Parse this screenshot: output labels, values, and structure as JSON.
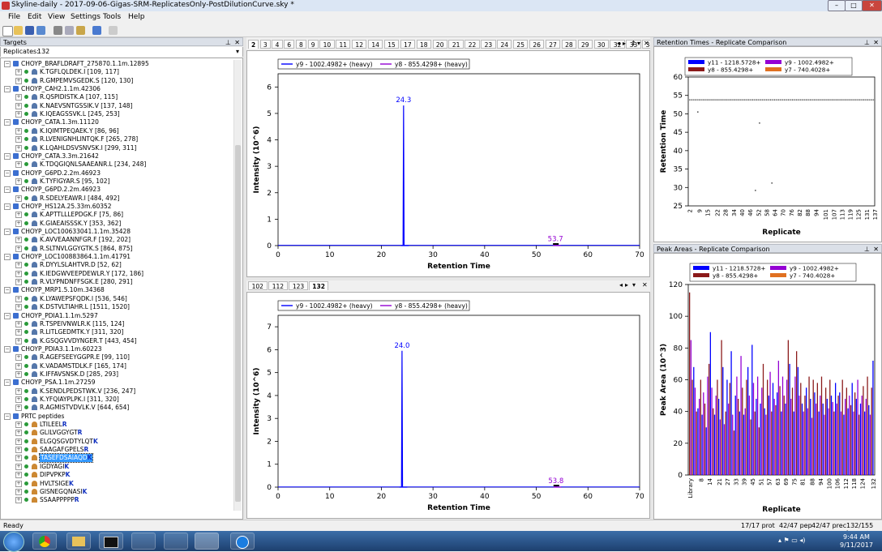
{
  "window": {
    "title": "Skyline-daily - 2017-09-06-Gigas-SRM-ReplicatesOnly-PostDilutionCurve.sky *",
    "buttons": [
      "–",
      "□",
      "✕"
    ]
  },
  "menu": [
    "File",
    "Edit",
    "View",
    "Settings",
    "Tools",
    "Help"
  ],
  "targets": {
    "title": "Targets",
    "replicates_label": "Replicates:",
    "replicates_value": "132",
    "rows": [
      {
        "level": 0,
        "kind": "protein",
        "text": "CHOYP_BRAFLDRAFT_275870.1.1m.12895"
      },
      {
        "level": 1,
        "kind": "peptide",
        "text": "K.TGFLQLDEK.I [109, 117]"
      },
      {
        "level": 1,
        "kind": "peptide",
        "text": "R.GMPEMVSGEDK.S [120, 130]"
      },
      {
        "level": 0,
        "kind": "protein",
        "text": "CHOYP_CAH2.1.1m.42306"
      },
      {
        "level": 1,
        "kind": "peptide",
        "text": "R.QSPIDISTK.A [107, 115]"
      },
      {
        "level": 1,
        "kind": "peptide",
        "text": "K.NAEVSNTGSSIK.V [137, 148]"
      },
      {
        "level": 1,
        "kind": "peptide",
        "text": "K.IQEAGSSVK.L [245, 253]"
      },
      {
        "level": 0,
        "kind": "protein",
        "text": "CHOYP_CATA.1.3m.11120"
      },
      {
        "level": 1,
        "kind": "peptide",
        "text": "K.IQIMTPEQAEK.Y [86, 96]"
      },
      {
        "level": 1,
        "kind": "peptide",
        "text": "R.LVENIGNHLINTQK.F [265, 278]"
      },
      {
        "level": 1,
        "kind": "peptide",
        "text": "K.LQAHLDSVSNVSK.I [299, 311]"
      },
      {
        "level": 0,
        "kind": "protein",
        "text": "CHOYP_CATA.3.3m.21642"
      },
      {
        "level": 1,
        "kind": "peptide",
        "text": "K.TDQGIQNLSAAEANR.L [234, 248]"
      },
      {
        "level": 0,
        "kind": "protein",
        "text": "CHOYP_G6PD.2.2m.46923"
      },
      {
        "level": 1,
        "kind": "peptide",
        "text": "K.TYFIGYAR.S [95, 102]"
      },
      {
        "level": 0,
        "kind": "protein",
        "text": "CHOYP_G6PD.2.2m.46923"
      },
      {
        "level": 1,
        "kind": "peptide",
        "text": "R.SDELYEAWR.I [484, 492]"
      },
      {
        "level": 0,
        "kind": "protein",
        "text": "CHOYP_HS12A.25.33m.60352"
      },
      {
        "level": 1,
        "kind": "peptide",
        "text": "K.APTTLLLEPDGK.F [75, 86]"
      },
      {
        "level": 1,
        "kind": "peptide",
        "text": "K.GIAEAISSSK.Y [353, 362]"
      },
      {
        "level": 0,
        "kind": "protein",
        "text": "CHOYP_LOC100633041.1.1m.35428"
      },
      {
        "level": 1,
        "kind": "peptide",
        "text": "K.AVVEAANNFGR.F [192, 202]"
      },
      {
        "level": 1,
        "kind": "peptide",
        "text": "R.SLTNVLGGYGTK.S [864, 875]"
      },
      {
        "level": 0,
        "kind": "protein",
        "text": "CHOYP_LOC100883864.1.1m.41791"
      },
      {
        "level": 1,
        "kind": "peptide",
        "text": "R.DYYLSLAHTVR.D [52, 62]"
      },
      {
        "level": 1,
        "kind": "peptide",
        "text": "K.IEDGWVEEPDEWLR.Y [172, 186]"
      },
      {
        "level": 1,
        "kind": "peptide",
        "text": "R.VLYPNDNFFSGK.E [280, 291]"
      },
      {
        "level": 0,
        "kind": "protein",
        "text": "CHOYP_MRP1.5.10m.34368"
      },
      {
        "level": 1,
        "kind": "peptide",
        "text": "K.LYAWEPSFQDK.I [536, 546]"
      },
      {
        "level": 1,
        "kind": "peptide",
        "text": "K.DSTVLTIAHR.L [1511, 1520]"
      },
      {
        "level": 0,
        "kind": "protein",
        "text": "CHOYP_PDIA1.1.1m.5297"
      },
      {
        "level": 1,
        "kind": "peptide",
        "text": "R.TSPEIVNWLR.K [115, 124]"
      },
      {
        "level": 1,
        "kind": "peptide",
        "text": "R.LITLGEDMTK.Y [311, 320]"
      },
      {
        "level": 1,
        "kind": "peptide",
        "text": "K.GSQGVVDYNGER.T [443, 454]"
      },
      {
        "level": 0,
        "kind": "protein",
        "text": "CHOYP_PDIA3.1.1m.60223"
      },
      {
        "level": 1,
        "kind": "peptide",
        "text": "R.AGEFSEEYGGPR.E [99, 110]"
      },
      {
        "level": 1,
        "kind": "peptide",
        "text": "K.VADAMSTDLK.F [165, 174]"
      },
      {
        "level": 1,
        "kind": "peptide",
        "text": "K.IFFAVSNSK.D [285, 293]"
      },
      {
        "level": 0,
        "kind": "protein",
        "text": "CHOYP_PSA.1.1m.27259"
      },
      {
        "level": 1,
        "kind": "peptide",
        "text": "K.SENDLPEDSTWK.V [236, 247]"
      },
      {
        "level": 1,
        "kind": "peptide",
        "text": "K.YFQIAYPLPK.I [311, 320]"
      },
      {
        "level": 1,
        "kind": "peptide",
        "text": "R.AGMISTVDVLK.V [644, 654]"
      },
      {
        "level": 0,
        "kind": "protein",
        "text": "PRTC peptides"
      },
      {
        "level": 1,
        "kind": "std",
        "text": "LTILEEL",
        "tail": "R"
      },
      {
        "level": 1,
        "kind": "std",
        "text": "GLILVGGYGT",
        "tail": "R"
      },
      {
        "level": 1,
        "kind": "std",
        "text": "ELGQSGVDTYLQT",
        "tail": "K"
      },
      {
        "level": 1,
        "kind": "std",
        "text": "SAAGAFGPELS",
        "tail": "R"
      },
      {
        "level": 1,
        "kind": "std",
        "text": "TASEFDSAIAQD",
        "tail": "K",
        "selected": true
      },
      {
        "level": 1,
        "kind": "std",
        "text": "IGDYAGI",
        "tail": "K"
      },
      {
        "level": 1,
        "kind": "std",
        "text": "DIPVPKP",
        "tail": "K"
      },
      {
        "level": 1,
        "kind": "std",
        "text": "HVLTSIGE",
        "tail": "K"
      },
      {
        "level": 1,
        "kind": "std",
        "text": "GISNEGQNASI",
        "tail": "K"
      },
      {
        "level": 1,
        "kind": "std",
        "text": "SSAAPPPPP",
        "tail": "R"
      }
    ]
  },
  "top_tabs": [
    "2",
    "3",
    "4",
    "6",
    "8",
    "9",
    "10",
    "11",
    "12",
    "14",
    "15",
    "17",
    "18",
    "20",
    "21",
    "22",
    "23",
    "24",
    "25",
    "26",
    "27",
    "28",
    "29",
    "30",
    "32",
    "33",
    "34",
    "35",
    "36",
    "3"
  ],
  "top_tabs_active": "2",
  "bottom_tabs": [
    "102",
    "112",
    "123",
    "132"
  ],
  "bottom_tabs_active": "132",
  "tab_nav": {
    "left": "◂",
    "right": "▸",
    "pin": "↕",
    "dropdown": "▾",
    "close": "✕"
  },
  "chrom_top": {
    "chart_data": {
      "type": "line",
      "xlabel": "Retention Time",
      "ylabel": "Intensity (10^6)",
      "xlim": [
        0,
        70
      ],
      "ylim": [
        0,
        6.5
      ],
      "xticks": [
        "0",
        "10",
        "20",
        "30",
        "40",
        "50",
        "60",
        "70"
      ],
      "yticks": [
        "0",
        "1",
        "2",
        "3",
        "4",
        "5",
        "6"
      ],
      "series": [
        {
          "name": "y9 - 1002.4982+ (heavy)",
          "color": "#0000ff",
          "peaks": [
            {
              "rt": 24.3,
              "height": 5.3,
              "label": "24.3"
            }
          ]
        },
        {
          "name": "y8 - 855.4298+ (heavy)",
          "color": "#9400d3",
          "peaks": [
            {
              "rt": 53.7,
              "height": 0.05,
              "label": "53.7"
            }
          ]
        }
      ]
    }
  },
  "chrom_bottom": {
    "chart_data": {
      "type": "line",
      "xlabel": "Retention Time",
      "ylabel": "Intensity (10^6)",
      "xlim": [
        0,
        70
      ],
      "ylim": [
        0,
        7.5
      ],
      "xticks": [
        "0",
        "10",
        "20",
        "30",
        "40",
        "50",
        "60",
        "70"
      ],
      "yticks": [
        "0",
        "1",
        "2",
        "3",
        "4",
        "5",
        "6",
        "7"
      ],
      "series": [
        {
          "name": "y9 - 1002.4982+ (heavy)",
          "color": "#0000ff",
          "peaks": [
            {
              "rt": 24.0,
              "height": 5.95,
              "label": "24.0"
            }
          ]
        },
        {
          "name": "y8 - 855.4298+ (heavy)",
          "color": "#9400d3",
          "peaks": [
            {
              "rt": 53.8,
              "height": 0.04,
              "label": "53.8"
            }
          ]
        }
      ]
    }
  },
  "rt_panel": {
    "title": "Retention Times - Replicate Comparison",
    "chart_data": {
      "type": "scatter",
      "xlabel": "Replicate",
      "ylabel": "Retention Time",
      "ylim": [
        25,
        60
      ],
      "yticks": [
        "25",
        "30",
        "35",
        "40",
        "45",
        "50",
        "55",
        "60"
      ],
      "xticks": [
        "2",
        "9",
        "15",
        "22",
        "28",
        "34",
        "40",
        "46",
        "52",
        "58",
        "64",
        "70",
        "76",
        "82",
        "88",
        "94",
        "101",
        "107",
        "113",
        "119",
        "125",
        "131",
        "137"
      ],
      "legend": [
        {
          "name": "y11 - 1218.5728+",
          "color": "#0000ff"
        },
        {
          "name": "y9 - 1002.4982+",
          "color": "#9400d3"
        },
        {
          "name": "y8 - 855.4298+",
          "color": "#8b1a1a"
        },
        {
          "name": "y7 - 740.4028+",
          "color": "#e07020"
        }
      ],
      "baseline_rt": 53.8,
      "outliers": [
        {
          "replicate": 8,
          "rt": 50.5
        },
        {
          "replicate": 53,
          "rt": 47.5
        },
        {
          "replicate": 50,
          "rt": 29.2
        },
        {
          "replicate": 62,
          "rt": 31.2
        }
      ]
    }
  },
  "pa_panel": {
    "title": "Peak Areas - Replicate Comparison",
    "chart_data": {
      "type": "bar",
      "xlabel": "Replicate",
      "ylabel": "Peak Area (10^3)",
      "ylim": [
        0,
        120
      ],
      "yticks": [
        "0",
        "20",
        "40",
        "60",
        "80",
        "100",
        "120"
      ],
      "xticks": [
        "Library",
        "8",
        "14",
        "21",
        "27",
        "33",
        "39",
        "45",
        "51",
        "57",
        "63",
        "69",
        "75",
        "81",
        "88",
        "94",
        "100",
        "106",
        "112",
        "118",
        "124",
        "132"
      ],
      "legend": [
        {
          "name": "y11 - 1218.5728+",
          "color": "#0000ff"
        },
        {
          "name": "y9 - 1002.4982+",
          "color": "#9400d3"
        },
        {
          "name": "y8 - 855.4298+",
          "color": "#8b1a1a"
        },
        {
          "name": "y7 - 740.4028+",
          "color": "#e07020"
        }
      ],
      "values": [
        115,
        85,
        60,
        68,
        55,
        40,
        42,
        48,
        60,
        38,
        52,
        45,
        30,
        62,
        70,
        90,
        55,
        42,
        38,
        50,
        60,
        48,
        35,
        85,
        68,
        32,
        40,
        60,
        45,
        58,
        78,
        38,
        28,
        50,
        62,
        48,
        40,
        75,
        55,
        38,
        42,
        60,
        68,
        50,
        35,
        82,
        58,
        40,
        48,
        62,
        30,
        45,
        55,
        70,
        42,
        38,
        60,
        50,
        65,
        40,
        58,
        48,
        44,
        52,
        72,
        56,
        40,
        62,
        50,
        45,
        60,
        85,
        70,
        48,
        55,
        40,
        62,
        78,
        68,
        50,
        58,
        45,
        40,
        50,
        55,
        42,
        62,
        48,
        36,
        60,
        52,
        45,
        58,
        40,
        50,
        62,
        45,
        38,
        55,
        48,
        42,
        60,
        50,
        46,
        40,
        58,
        45,
        50,
        52,
        40,
        60,
        38,
        48,
        55,
        42,
        50,
        44,
        58,
        40,
        52,
        48,
        60,
        38,
        45,
        50,
        56,
        40,
        48,
        62,
        44,
        38,
        55,
        72
      ]
    }
  },
  "status": {
    "left": "Ready",
    "prot": "17/17 prot",
    "pep": "42/47 pep",
    "prec": "42/47 prec",
    "tran": "132/155 tran"
  },
  "taskbar": {
    "time": "9:44 AM",
    "date": "9/11/2017"
  }
}
